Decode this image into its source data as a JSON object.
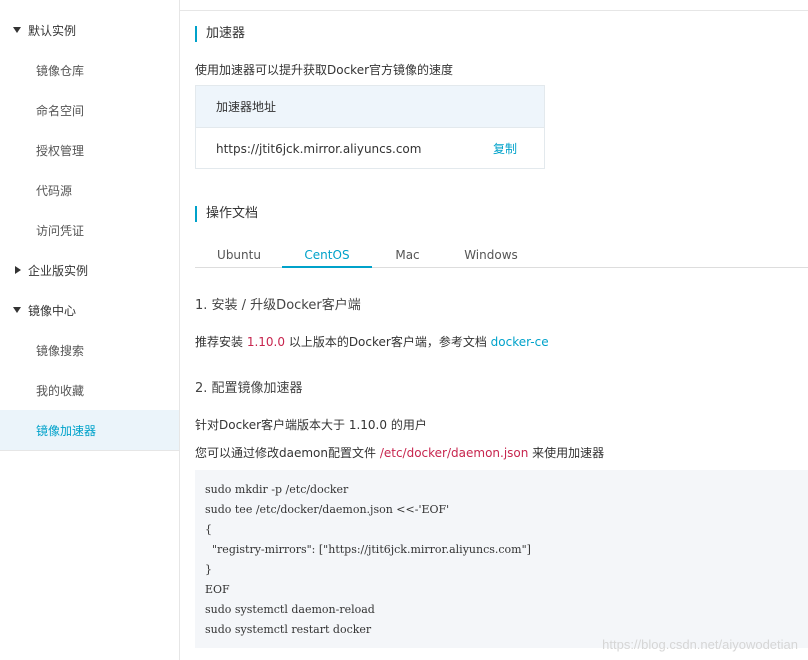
{
  "sidebar": {
    "groups": [
      {
        "label": "默认实例",
        "expanded": true
      },
      {
        "label": "企业版实例",
        "expanded": false
      },
      {
        "label": "镜像中心",
        "expanded": true
      }
    ],
    "items": [
      {
        "label": "镜像仓库"
      },
      {
        "label": "命名空间"
      },
      {
        "label": "授权管理"
      },
      {
        "label": "代码源"
      },
      {
        "label": "访问凭证"
      },
      {
        "label": "镜像搜索"
      },
      {
        "label": "我的收藏"
      },
      {
        "label": "镜像加速器",
        "active": true
      }
    ]
  },
  "accelerator": {
    "title": "加速器",
    "description": "使用加速器可以提升获取Docker官方镜像的速度",
    "table_header": "加速器地址",
    "address": "https://jtit6jck.mirror.aliyuncs.com",
    "copy_label": "复制"
  },
  "docs": {
    "title": "操作文档",
    "tabs": [
      "Ubuntu",
      "CentOS",
      "Mac",
      "Windows"
    ],
    "active_tab": "CentOS",
    "step1_title": "1. 安装 / 升级Docker客户端",
    "step1_text_before": "推荐安装 ",
    "step1_version": "1.10.0",
    "step1_text_after": " 以上版本的Docker客户端，参考文档 ",
    "step1_link": "docker-ce",
    "step2_title": "2. 配置镜像加速器",
    "step2_text1": "针对Docker客户端版本大于 1.10.0 的用户",
    "step2_text2_before": "您可以通过修改daemon配置文件 ",
    "step2_path": "/etc/docker/daemon.json",
    "step2_text2_after": " 来使用加速器",
    "code_lines": [
      "sudo mkdir -p /etc/docker",
      "sudo tee /etc/docker/daemon.json <<-'EOF'",
      "{",
      "  \"registry-mirrors\": [\"https://jtit6jck.mirror.aliyuncs.com\"]",
      "}",
      "EOF",
      "sudo systemctl daemon-reload",
      "sudo systemctl restart docker"
    ]
  },
  "watermark": "https://blog.csdn.net/aiyowodetian",
  "colors": {
    "accent": "#00a2ca",
    "highlight": "#c7254e",
    "active_bg": "#ebf4fa"
  }
}
